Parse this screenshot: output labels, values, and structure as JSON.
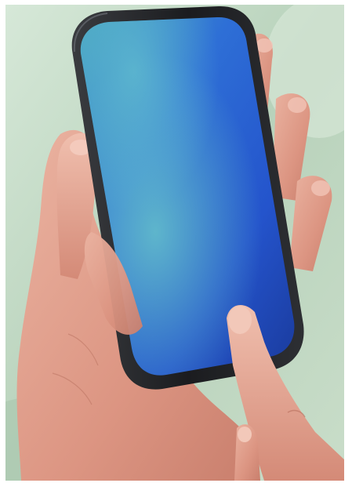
{
  "image": {
    "kind": "photograph",
    "subject": "hand-holding-smartphone",
    "background_color": "#c4dac6",
    "skin_color": "#e3a08e",
    "phone_frame_color": "#1e1f22",
    "screen_colors": [
      "#5fb3c7",
      "#2a5ad8",
      "#1b3fb4"
    ]
  }
}
